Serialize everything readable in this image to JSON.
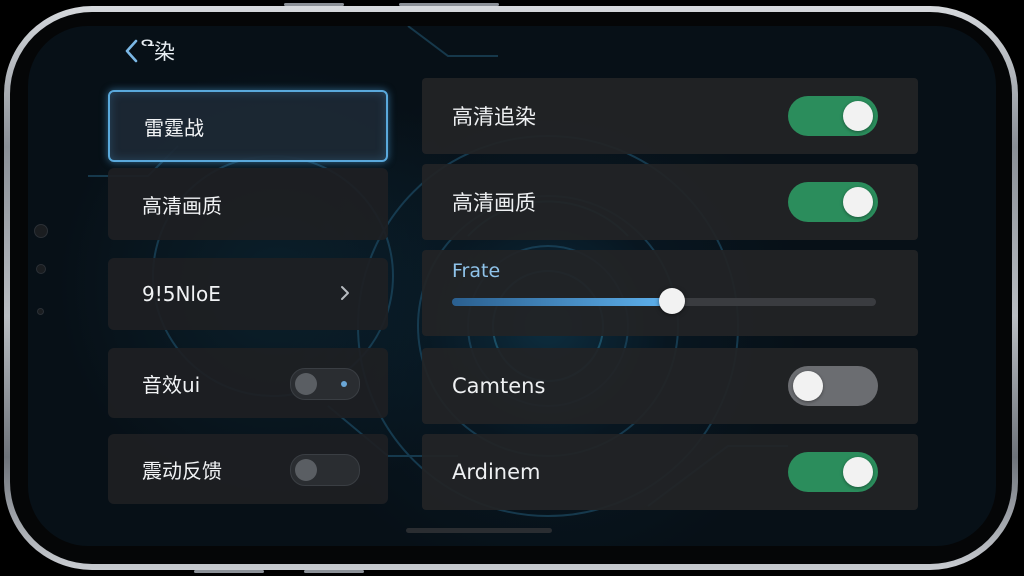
{
  "header": {
    "back_label": "ີ染"
  },
  "left_menu": [
    {
      "label": "雷霆战",
      "active": true
    },
    {
      "label": "高清画质"
    },
    {
      "label": "9!5NloE",
      "has_chevron": true
    },
    {
      "label": "音效ui",
      "toggle": "off"
    },
    {
      "label": "震动反馈",
      "toggle": "off"
    }
  ],
  "settings": {
    "hd_render": {
      "label": "高清追染",
      "state": "on"
    },
    "hd_quality": {
      "label": "高清画质",
      "state": "on"
    },
    "frate": {
      "label": "Frate",
      "value": 0.52
    },
    "camtens": {
      "label": "Camtens",
      "state": "off"
    },
    "ardinem": {
      "label": "Ardinem",
      "state": "on"
    }
  },
  "colors": {
    "accent": "#5aa9dc",
    "toggle_on": "#2b8d5c",
    "toggle_off": "#6b6d71",
    "slider": "#5fb2ee"
  },
  "icons": [
    "chevron-left-icon",
    "chevron-right-icon"
  ]
}
